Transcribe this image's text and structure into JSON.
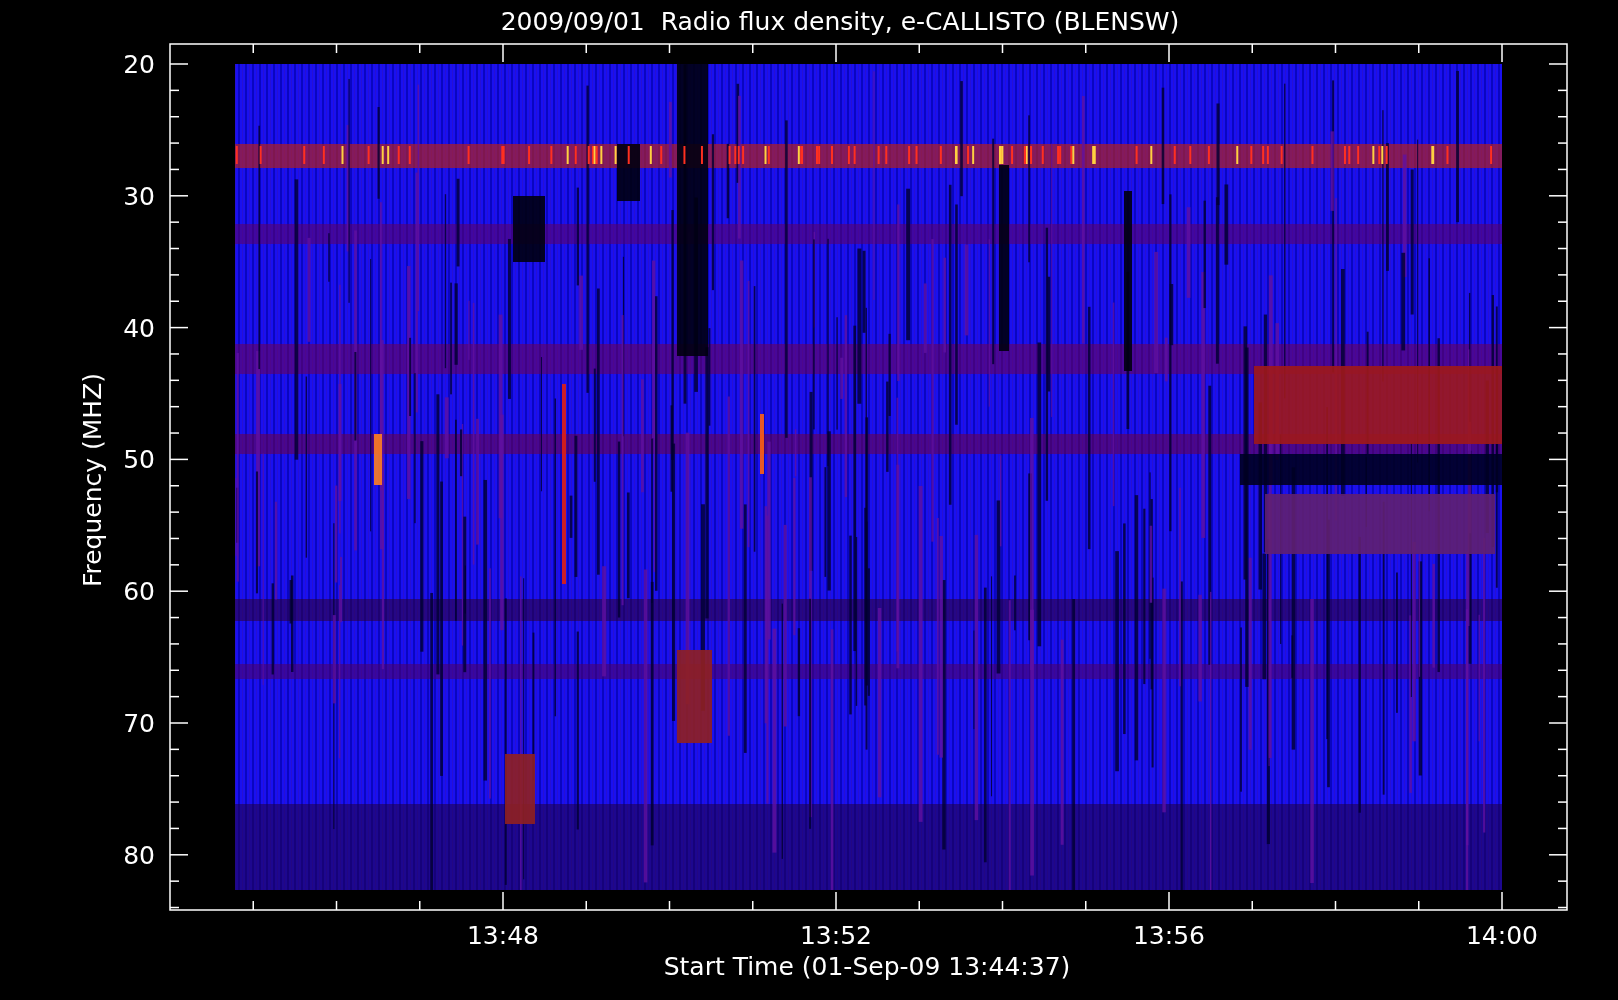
{
  "plot": {
    "title": "2009/09/01  Radio flux density, e-CALLISTO (BLENSW)",
    "xlabel": "Start Time (01-Sep-09 13:44:37)",
    "ylabel": "Frequency (MHZ)",
    "y_tick_labels": [
      "20",
      "30",
      "40",
      "50",
      "60",
      "70",
      "80"
    ],
    "x_tick_labels": [
      "13:48",
      "13:52",
      "13:56",
      "14:00"
    ]
  }
}
